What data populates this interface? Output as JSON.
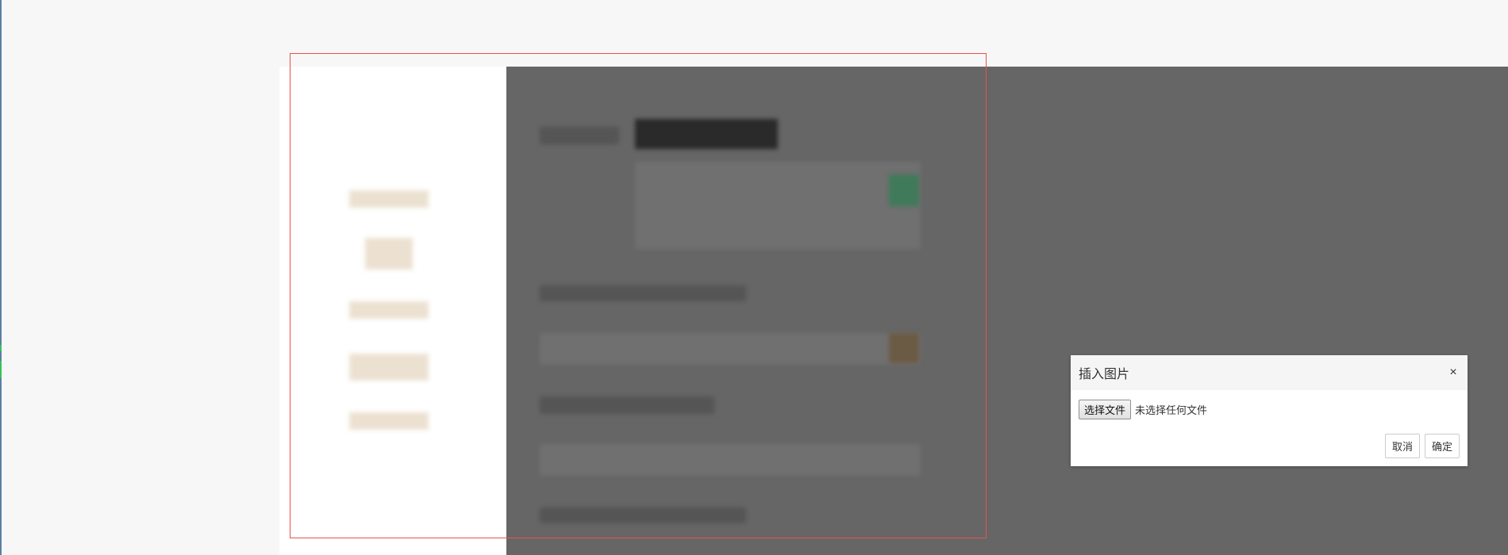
{
  "dialog": {
    "title": "插入图片",
    "close_icon": "×",
    "file_button_label": "选择文件",
    "file_status": "未选择任何文件",
    "cancel_label": "取消",
    "confirm_label": "确定"
  }
}
